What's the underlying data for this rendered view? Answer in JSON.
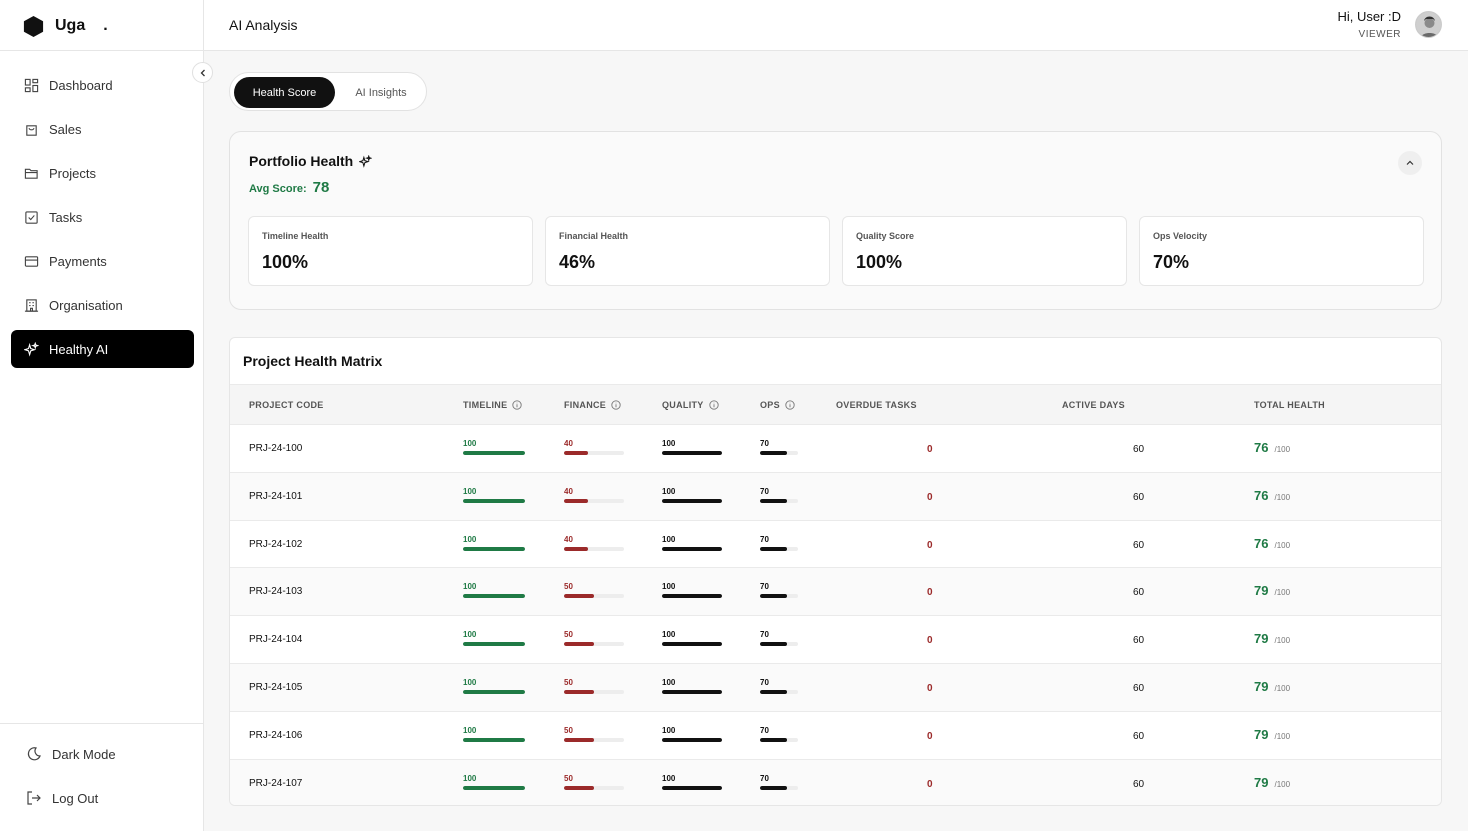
{
  "brand": {
    "name": "Uga",
    "dot": "."
  },
  "nav": [
    {
      "label": "Dashboard",
      "icon": "grid-icon"
    },
    {
      "label": "Sales",
      "icon": "bag-icon"
    },
    {
      "label": "Projects",
      "icon": "folder-icon"
    },
    {
      "label": "Tasks",
      "icon": "checkbox-icon"
    },
    {
      "label": "Payments",
      "icon": "card-icon"
    },
    {
      "label": "Organisation",
      "icon": "building-icon"
    },
    {
      "label": "Healthy AI",
      "icon": "sparkle-icon",
      "active": true
    }
  ],
  "sidebar_bottom": {
    "dark_mode": "Dark Mode",
    "logout": "Log Out"
  },
  "header": {
    "title": "AI Analysis",
    "greeting": "Hi, User :D",
    "role": "VIEWER"
  },
  "tabs": [
    {
      "label": "Health Score",
      "active": true
    },
    {
      "label": "AI Insights",
      "active": false
    }
  ],
  "portfolio": {
    "title": "Portfolio Health",
    "avg_label": "Avg Score:",
    "avg_value": "78",
    "metrics": [
      {
        "label": "Timeline Health",
        "value": "100%"
      },
      {
        "label": "Financial Health",
        "value": "46%"
      },
      {
        "label": "Quality Score",
        "value": "100%"
      },
      {
        "label": "Ops Velocity",
        "value": "70%"
      }
    ]
  },
  "matrix": {
    "title": "Project Health Matrix",
    "columns": {
      "code": "PROJECT CODE",
      "timeline": "TIMELINE",
      "finance": "FINANCE",
      "quality": "QUALITY",
      "ops": "OPS",
      "overdue": "OVERDUE TASKS",
      "days": "ACTIVE DAYS",
      "total": "TOTAL HEALTH"
    },
    "total_suffix": "/100",
    "rows": [
      {
        "code": "PRJ-24-100",
        "timeline": 100,
        "finance": 40,
        "quality": 100,
        "ops": 70,
        "overdue": "0",
        "days": "60",
        "total": "76"
      },
      {
        "code": "PRJ-24-101",
        "timeline": 100,
        "finance": 40,
        "quality": 100,
        "ops": 70,
        "overdue": "0",
        "days": "60",
        "total": "76"
      },
      {
        "code": "PRJ-24-102",
        "timeline": 100,
        "finance": 40,
        "quality": 100,
        "ops": 70,
        "overdue": "0",
        "days": "60",
        "total": "76"
      },
      {
        "code": "PRJ-24-103",
        "timeline": 100,
        "finance": 50,
        "quality": 100,
        "ops": 70,
        "overdue": "0",
        "days": "60",
        "total": "79"
      },
      {
        "code": "PRJ-24-104",
        "timeline": 100,
        "finance": 50,
        "quality": 100,
        "ops": 70,
        "overdue": "0",
        "days": "60",
        "total": "79"
      },
      {
        "code": "PRJ-24-105",
        "timeline": 100,
        "finance": 50,
        "quality": 100,
        "ops": 70,
        "overdue": "0",
        "days": "60",
        "total": "79"
      },
      {
        "code": "PRJ-24-106",
        "timeline": 100,
        "finance": 50,
        "quality": 100,
        "ops": 70,
        "overdue": "0",
        "days": "60",
        "total": "79"
      },
      {
        "code": "PRJ-24-107",
        "timeline": 100,
        "finance": 50,
        "quality": 100,
        "ops": 70,
        "overdue": "0",
        "days": "60",
        "total": "79"
      }
    ]
  },
  "colors": {
    "timeline": "#1f7a45",
    "finance": "#9b2a2a",
    "quality": "#111111",
    "ops": "#111111",
    "accent": "#1f7a45"
  }
}
